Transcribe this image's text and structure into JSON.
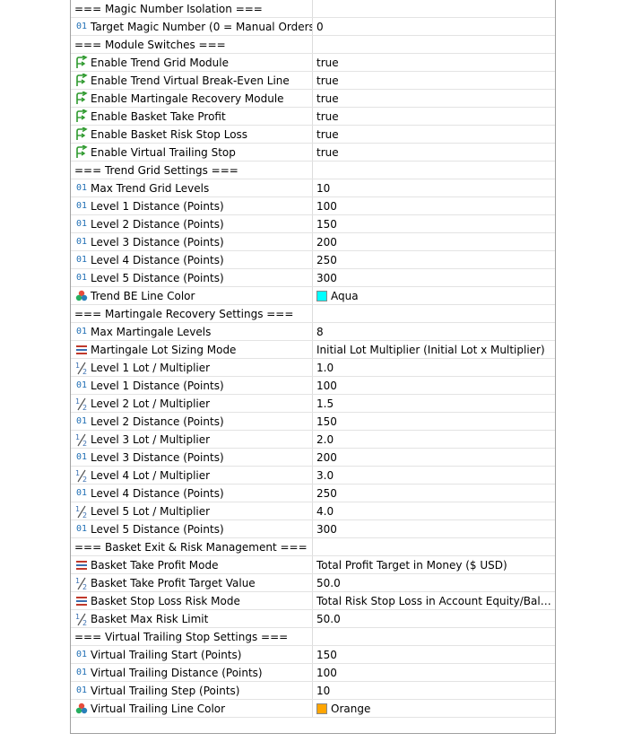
{
  "rows": [
    {
      "type": "section",
      "name": "=== Magic Number Isolation ===",
      "value": ""
    },
    {
      "type": "int",
      "name": "Target Magic Number (0 = Manual Orders)",
      "value": "0"
    },
    {
      "type": "section",
      "name": "=== Module Switches ===",
      "value": ""
    },
    {
      "type": "bool",
      "name": "Enable Trend Grid Module",
      "value": "true"
    },
    {
      "type": "bool",
      "name": "Enable Trend Virtual Break-Even Line",
      "value": "true"
    },
    {
      "type": "bool",
      "name": "Enable Martingale Recovery Module",
      "value": "true"
    },
    {
      "type": "bool",
      "name": "Enable Basket Take Profit",
      "value": "true"
    },
    {
      "type": "bool",
      "name": "Enable Basket Risk Stop Loss",
      "value": "true"
    },
    {
      "type": "bool",
      "name": "Enable Virtual Trailing Stop",
      "value": "true"
    },
    {
      "type": "section",
      "name": "=== Trend Grid Settings ===",
      "value": ""
    },
    {
      "type": "int",
      "name": "Max Trend Grid Levels",
      "value": "10"
    },
    {
      "type": "int",
      "name": "Level 1 Distance (Points)",
      "value": "100"
    },
    {
      "type": "int",
      "name": "Level 2 Distance (Points)",
      "value": "150"
    },
    {
      "type": "int",
      "name": "Level 3 Distance (Points)",
      "value": "200"
    },
    {
      "type": "int",
      "name": "Level 4 Distance (Points)",
      "value": "250"
    },
    {
      "type": "int",
      "name": "Level 5 Distance (Points)",
      "value": "300"
    },
    {
      "type": "color",
      "name": "Trend BE Line Color",
      "value": "Aqua",
      "swatch": "#00ffff"
    },
    {
      "type": "section",
      "name": "=== Martingale Recovery Settings ===",
      "value": ""
    },
    {
      "type": "int",
      "name": "Max Martingale Levels",
      "value": "8"
    },
    {
      "type": "enum",
      "name": "Martingale Lot Sizing Mode",
      "value": "Initial Lot Multiplier (Initial Lot x Multiplier)"
    },
    {
      "type": "double",
      "name": "Level 1 Lot / Multiplier",
      "value": "1.0"
    },
    {
      "type": "int",
      "name": "Level 1 Distance (Points)",
      "value": "100"
    },
    {
      "type": "double",
      "name": "Level 2 Lot / Multiplier",
      "value": "1.5"
    },
    {
      "type": "int",
      "name": "Level 2 Distance (Points)",
      "value": "150"
    },
    {
      "type": "double",
      "name": "Level 3 Lot / Multiplier",
      "value": "2.0"
    },
    {
      "type": "int",
      "name": "Level 3 Distance (Points)",
      "value": "200"
    },
    {
      "type": "double",
      "name": "Level 4 Lot / Multiplier",
      "value": "3.0"
    },
    {
      "type": "int",
      "name": "Level 4 Distance (Points)",
      "value": "250"
    },
    {
      "type": "double",
      "name": "Level 5 Lot / Multiplier",
      "value": "4.0"
    },
    {
      "type": "int",
      "name": "Level 5 Distance (Points)",
      "value": "300"
    },
    {
      "type": "section",
      "name": "=== Basket Exit & Risk Management ===",
      "value": ""
    },
    {
      "type": "enum",
      "name": "Basket Take Profit Mode",
      "value": "Total Profit Target in Money ($ USD)"
    },
    {
      "type": "double",
      "name": "Basket Take Profit Target Value",
      "value": "50.0"
    },
    {
      "type": "enum",
      "name": "Basket Stop Loss Risk Mode",
      "value": "Total Risk Stop Loss in Account Equity/Balanc..."
    },
    {
      "type": "double",
      "name": "Basket Max Risk Limit",
      "value": "50.0"
    },
    {
      "type": "section",
      "name": "=== Virtual Trailing Stop Settings ===",
      "value": ""
    },
    {
      "type": "int",
      "name": "Virtual Trailing Start (Points)",
      "value": "150"
    },
    {
      "type": "int",
      "name": "Virtual Trailing Distance (Points)",
      "value": "100"
    },
    {
      "type": "int",
      "name": "Virtual Trailing Step (Points)",
      "value": "10"
    },
    {
      "type": "color",
      "name": "Virtual Trailing Line Color",
      "value": "Orange",
      "swatch": "#ffa500"
    }
  ],
  "icons": {
    "int": "integer-icon",
    "bool": "boolean-arrow-icon",
    "double": "fraction-icon",
    "enum": "enumeration-icon",
    "color": "palette-icon"
  },
  "int_icon_text": "01",
  "colors": {
    "int_icon": "#1f6fb5",
    "bool_icon": "#2e9a2e",
    "enum_icon": "#c0392b",
    "border": "#a0a0a0"
  }
}
